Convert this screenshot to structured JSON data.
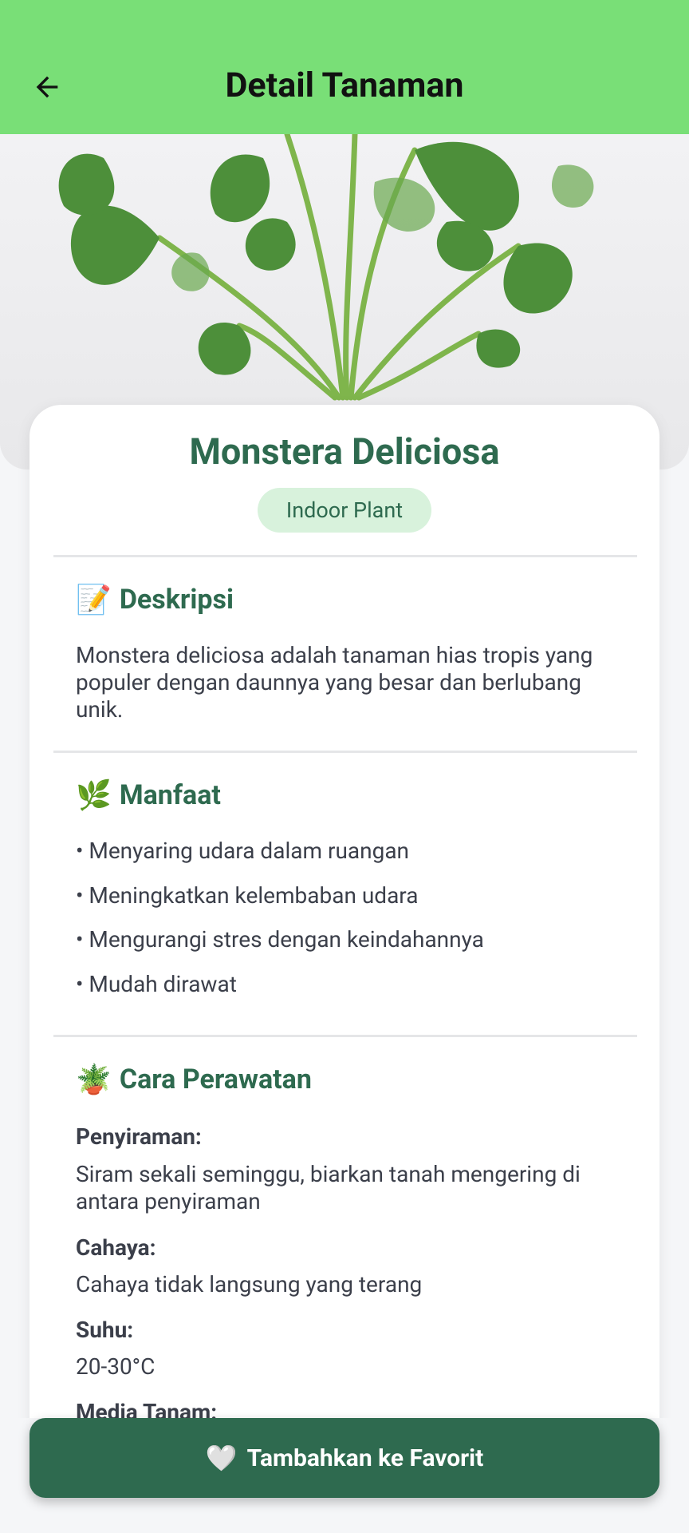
{
  "header": {
    "title": "Detail Tanaman",
    "back_icon": "arrow-left-icon",
    "background_color": "#79df77"
  },
  "plant": {
    "name": "Monstera Deliciosa",
    "category": "Indoor Plant",
    "image": "monstera-plant-photo"
  },
  "sections": {
    "description": {
      "emoji": "📝",
      "title": "Deskripsi",
      "text": "Monstera deliciosa adalah tanaman hias tropis yang populer dengan daunnya yang besar dan berlubang unik."
    },
    "benefits": {
      "emoji": "🌿",
      "title": "Manfaat",
      "items": [
        "• Menyaring udara dalam ruangan",
        "• Meningkatkan kelembaban udara",
        "• Mengurangi stres dengan keindahannya",
        "• Mudah dirawat"
      ]
    },
    "care": {
      "emoji": "🪴",
      "title": "Cara Perawatan",
      "items": [
        {
          "label": "Penyiraman:",
          "value": "Siram sekali seminggu, biarkan tanah mengering di antara penyiraman"
        },
        {
          "label": "Cahaya:",
          "value": "Cahaya tidak langsung yang terang"
        },
        {
          "label": "Suhu:",
          "value": "20-30°C"
        },
        {
          "label": "Media Tanam:",
          "value": ""
        }
      ]
    }
  },
  "favorite_button": {
    "icon": "🤍",
    "label": "Tambahkan ke Favorit",
    "color": "#2e6a4f"
  },
  "colors": {
    "accent": "#2e6a4f",
    "chip_background": "#d8f2dc"
  }
}
